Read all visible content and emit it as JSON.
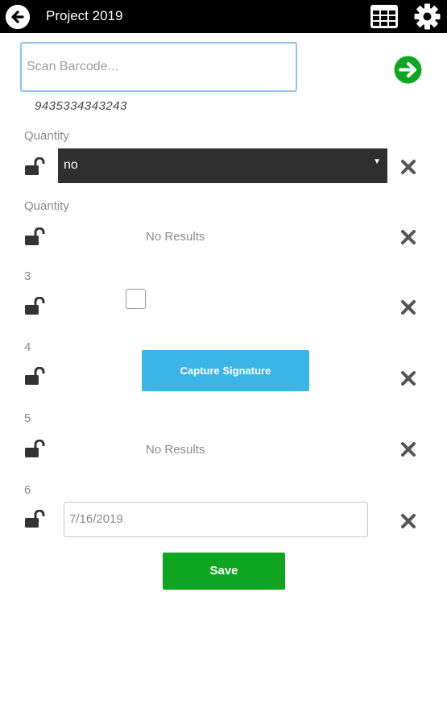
{
  "header": {
    "title": "Project 2019",
    "back_icon": "arrow-left-circle-icon",
    "grid_icon": "table-grid-icon",
    "settings_icon": "gear-icon"
  },
  "scan": {
    "placeholder": "Scan Barcode...",
    "value": "",
    "go_icon": "arrow-right-circle-icon",
    "barcode": "9435334343243"
  },
  "fields": [
    {
      "label": "Quantity",
      "type": "select",
      "value": "no"
    },
    {
      "label": "Quantity",
      "type": "results",
      "value": "No Results"
    },
    {
      "label": "3",
      "type": "checkbox",
      "checked": false
    },
    {
      "label": "4",
      "type": "signature",
      "button_label": "Capture Signature"
    },
    {
      "label": "5",
      "type": "results",
      "value": "No Results"
    },
    {
      "label": "6",
      "type": "date",
      "value": "7/16/2019"
    }
  ],
  "save_label": "Save",
  "colors": {
    "header_bg": "#000000",
    "go_green": "#0fa520",
    "signature_blue": "#3cb4e5",
    "save_green": "#0fa520",
    "select_bg": "#2f2f2f",
    "input_focus_border": "#8fc3ec"
  }
}
